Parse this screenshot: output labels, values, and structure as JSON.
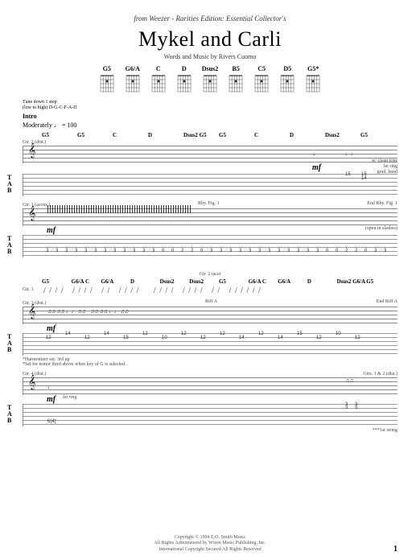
{
  "source_prefix": "from Weezer - ",
  "source_album": "Rarities Edition: Essential Collector's",
  "title": "Mykel and Carli",
  "byline": "Words and Music by Rivers Cuomo",
  "chord_diagrams": [
    "G5",
    "G6/A",
    "C",
    "D",
    "Dsus2",
    "B5",
    "C5",
    "D5",
    "G5*"
  ],
  "tuning_line1": "Tune down 1 step",
  "tuning_line2": "(low to high) D-G-C-F-A-D",
  "intro_label": "Intro",
  "tempo_label": "Moderately ♩ = 100",
  "system1": {
    "chords": [
      "G5",
      "G5",
      "C",
      "D",
      "Dsus2 G5",
      "G5",
      "C",
      "D",
      "Dsus2",
      "G5"
    ],
    "gtr2_label": "Gtr. 2 (dist.)",
    "dyn": "mf",
    "perf_note1": "w/ clean tone",
    "perf_note2": "let ring",
    "perf_note3": "grad. bend",
    "tab_high": [
      "15",
      "15",
      "14"
    ],
    "gtr1_label": "Gtr. 1 (acous.)",
    "rhy_start": "Rhy. Fig. 1",
    "rhy_end": "End Rhy. Fig. 1",
    "dyn2": "mf",
    "open_note": "(open in slashes)",
    "tab_pattern": [
      "3",
      "3",
      "3",
      "3",
      "3",
      "3",
      "3",
      "3",
      "3",
      "3",
      "3",
      "3",
      "0",
      "0",
      "2",
      "2",
      "0",
      "3",
      "3",
      "3",
      "3",
      "3",
      "3",
      "3",
      "3",
      "3",
      "3",
      "3",
      "3",
      "0",
      "0",
      "2",
      "2",
      "0",
      "3",
      "3"
    ]
  },
  "system2": {
    "gtr2_tacet": "Gtr. 2 tacet",
    "chords": [
      "G5",
      "G6/A C",
      "G6/A",
      "D",
      "Dsus2",
      "Dsus2",
      "G5",
      "G6/A C",
      "G6/A",
      "D",
      "Dsus2 G6/A",
      "G5"
    ],
    "gtr1_label": "Gtr. 1",
    "gtr3_label": "Gtr. 3 (dist.)",
    "riff_start": "Riff A",
    "riff_end": "End Riff A",
    "dyn": "mf",
    "tab_riff": [
      "12",
      "14",
      "12",
      "14",
      "15",
      "12",
      "10",
      "12",
      "12",
      "12",
      "14",
      "12",
      "14",
      "15",
      "12",
      "10",
      "12"
    ],
    "harm_label": "*Harmonizer set: 3rd up",
    "harm_note": "*Set for minor third above when key of G is selected.",
    "gtr4_label": "Gtr. 4 (dist.)",
    "dyn4": "mf",
    "gtrs12_label": "Gtrs. 1 & 2 (dist.)",
    "let_ring": "let ring",
    "tab_low": "6(4)",
    "vib_note": "***1st string",
    "tab_end": [
      "3",
      "3",
      "3",
      "3"
    ]
  },
  "copyright": [
    "Copyright © 1994 E.O. Smith Music",
    "All Rights Administered by Wixen Music Publishing, Inc.",
    "International Copyright Secured   All Rights Reserved"
  ],
  "page_number": "1"
}
